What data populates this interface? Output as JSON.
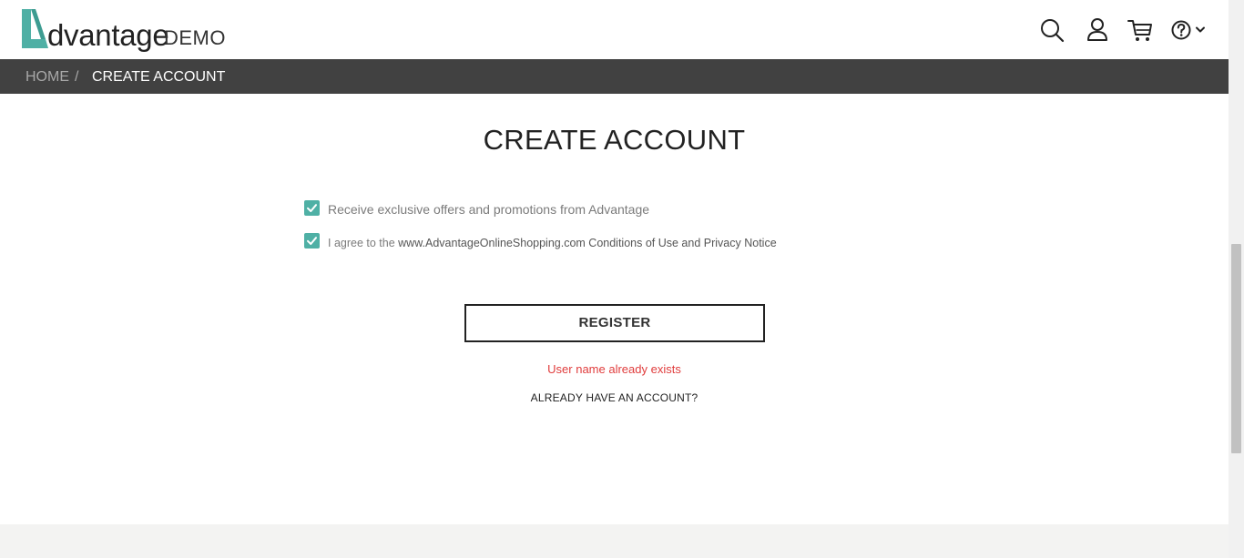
{
  "header": {
    "logo_text": "dvantage",
    "logo_demo": "DEMO",
    "icons": [
      "search-icon",
      "user-icon",
      "cart-icon",
      "help-icon",
      "chevron-down-icon"
    ]
  },
  "breadcrumb": {
    "home": "HOME",
    "separator": "/",
    "current": "CREATE ACCOUNT"
  },
  "main": {
    "title": "CREATE ACCOUNT",
    "offers_checkbox": {
      "label": "Receive exclusive offers and promotions from Advantage",
      "checked": true
    },
    "agree_checkbox": {
      "label_prefix": "I agree to the ",
      "label_link": "www.AdvantageOnlineShopping.com Conditions of Use and Privacy Notice",
      "checked": true
    },
    "register_label": "REGISTER",
    "error_message": "User name already exists",
    "already_account_label": "ALREADY HAVE AN ACCOUNT?"
  },
  "colors": {
    "accent": "#4fb0a5",
    "breadcrumb_bg": "#414141",
    "error": "#e03c3c"
  }
}
